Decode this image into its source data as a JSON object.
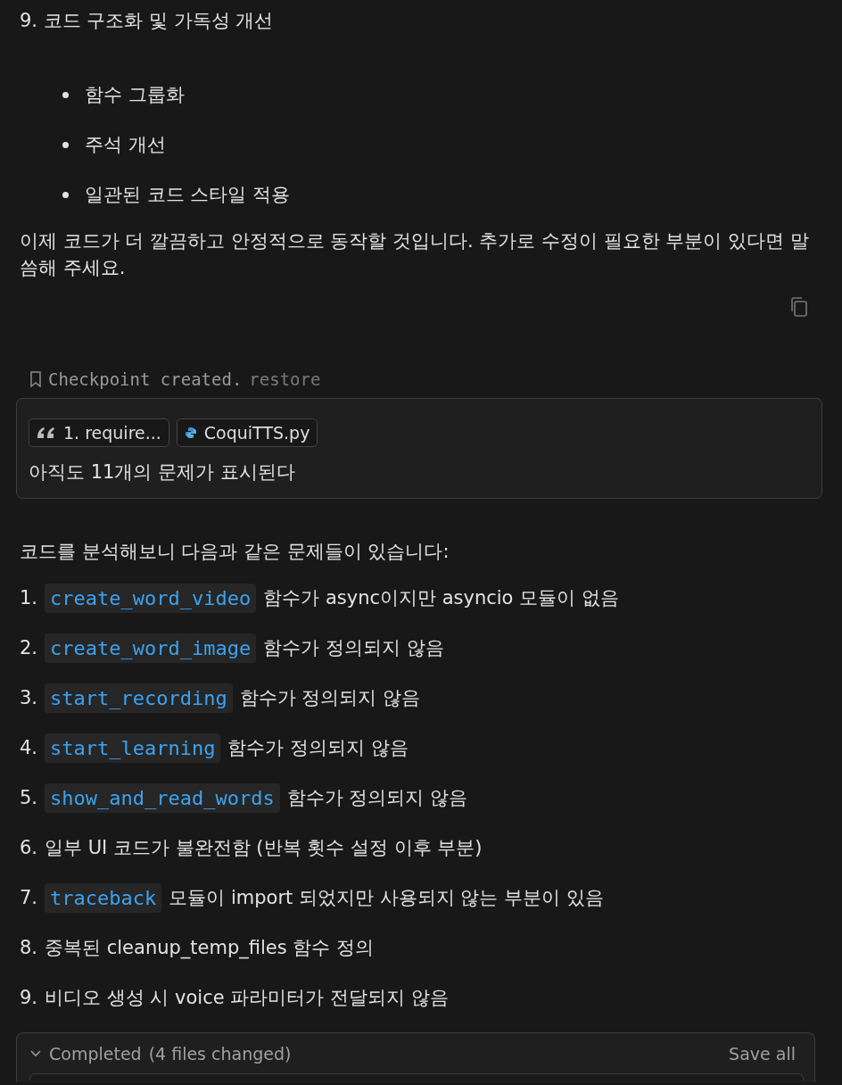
{
  "summary_item": {
    "number": "9.",
    "text": "코드 구조화 및 가독성 개선",
    "bullets": [
      "함수 그룹화",
      "주석 개선",
      "일관된 코드 스타일 적용"
    ]
  },
  "closing": "이제 코드가 더 깔끔하고 안정적으로 동작할 것입니다. 추가로 수정이 필요한 부분이 있다면 말씀해 주세요.",
  "checkpoint": {
    "text": "Checkpoint created.",
    "action": "restore"
  },
  "user_message": {
    "chips": [
      {
        "kind": "quote",
        "label": "1. require..."
      },
      {
        "kind": "python",
        "label": "CoquiTTS.py"
      }
    ],
    "text": "아직도 11개의 문제가 표시된다"
  },
  "intro": "코드를 분석해보니 다음과 같은 문제들이 있습니다:",
  "issues": [
    {
      "number": "1.",
      "parts": [
        {
          "kind": "code",
          "text": "create_word_video"
        },
        {
          "kind": "text",
          "text": "함수가 async이지만 asyncio 모듈이 없음"
        }
      ]
    },
    {
      "number": "2.",
      "parts": [
        {
          "kind": "code",
          "text": "create_word_image"
        },
        {
          "kind": "text",
          "text": "함수가 정의되지 않음"
        }
      ]
    },
    {
      "number": "3.",
      "parts": [
        {
          "kind": "code",
          "text": "start_recording"
        },
        {
          "kind": "text",
          "text": "함수가 정의되지 않음"
        }
      ]
    },
    {
      "number": "4.",
      "parts": [
        {
          "kind": "code",
          "text": "start_learning"
        },
        {
          "kind": "text",
          "text": "함수가 정의되지 않음"
        }
      ]
    },
    {
      "number": "5.",
      "parts": [
        {
          "kind": "code",
          "text": "show_and_read_words"
        },
        {
          "kind": "text",
          "text": "함수가 정의되지 않음"
        }
      ]
    },
    {
      "number": "6.",
      "parts": [
        {
          "kind": "text",
          "text": "일부 UI 코드가 불완전함 (반복 횟수 설정 이후 부분)"
        }
      ]
    },
    {
      "number": "7.",
      "parts": [
        {
          "kind": "code",
          "text": "traceback"
        },
        {
          "kind": "text",
          "text": "모듈이 import 되었지만 사용되지 않는 부분이 있음"
        }
      ]
    },
    {
      "number": "8.",
      "parts": [
        {
          "kind": "text",
          "text": "중복된 cleanup_temp_files 함수 정의"
        }
      ]
    },
    {
      "number": "9.",
      "parts": [
        {
          "kind": "text",
          "text": "비디오 생성 시 voice 파라미터가 전달되지 않음"
        }
      ]
    }
  ],
  "completed": {
    "expanded": true,
    "label": "Completed",
    "detail": "(4 files changed)",
    "action": "Save all"
  }
}
